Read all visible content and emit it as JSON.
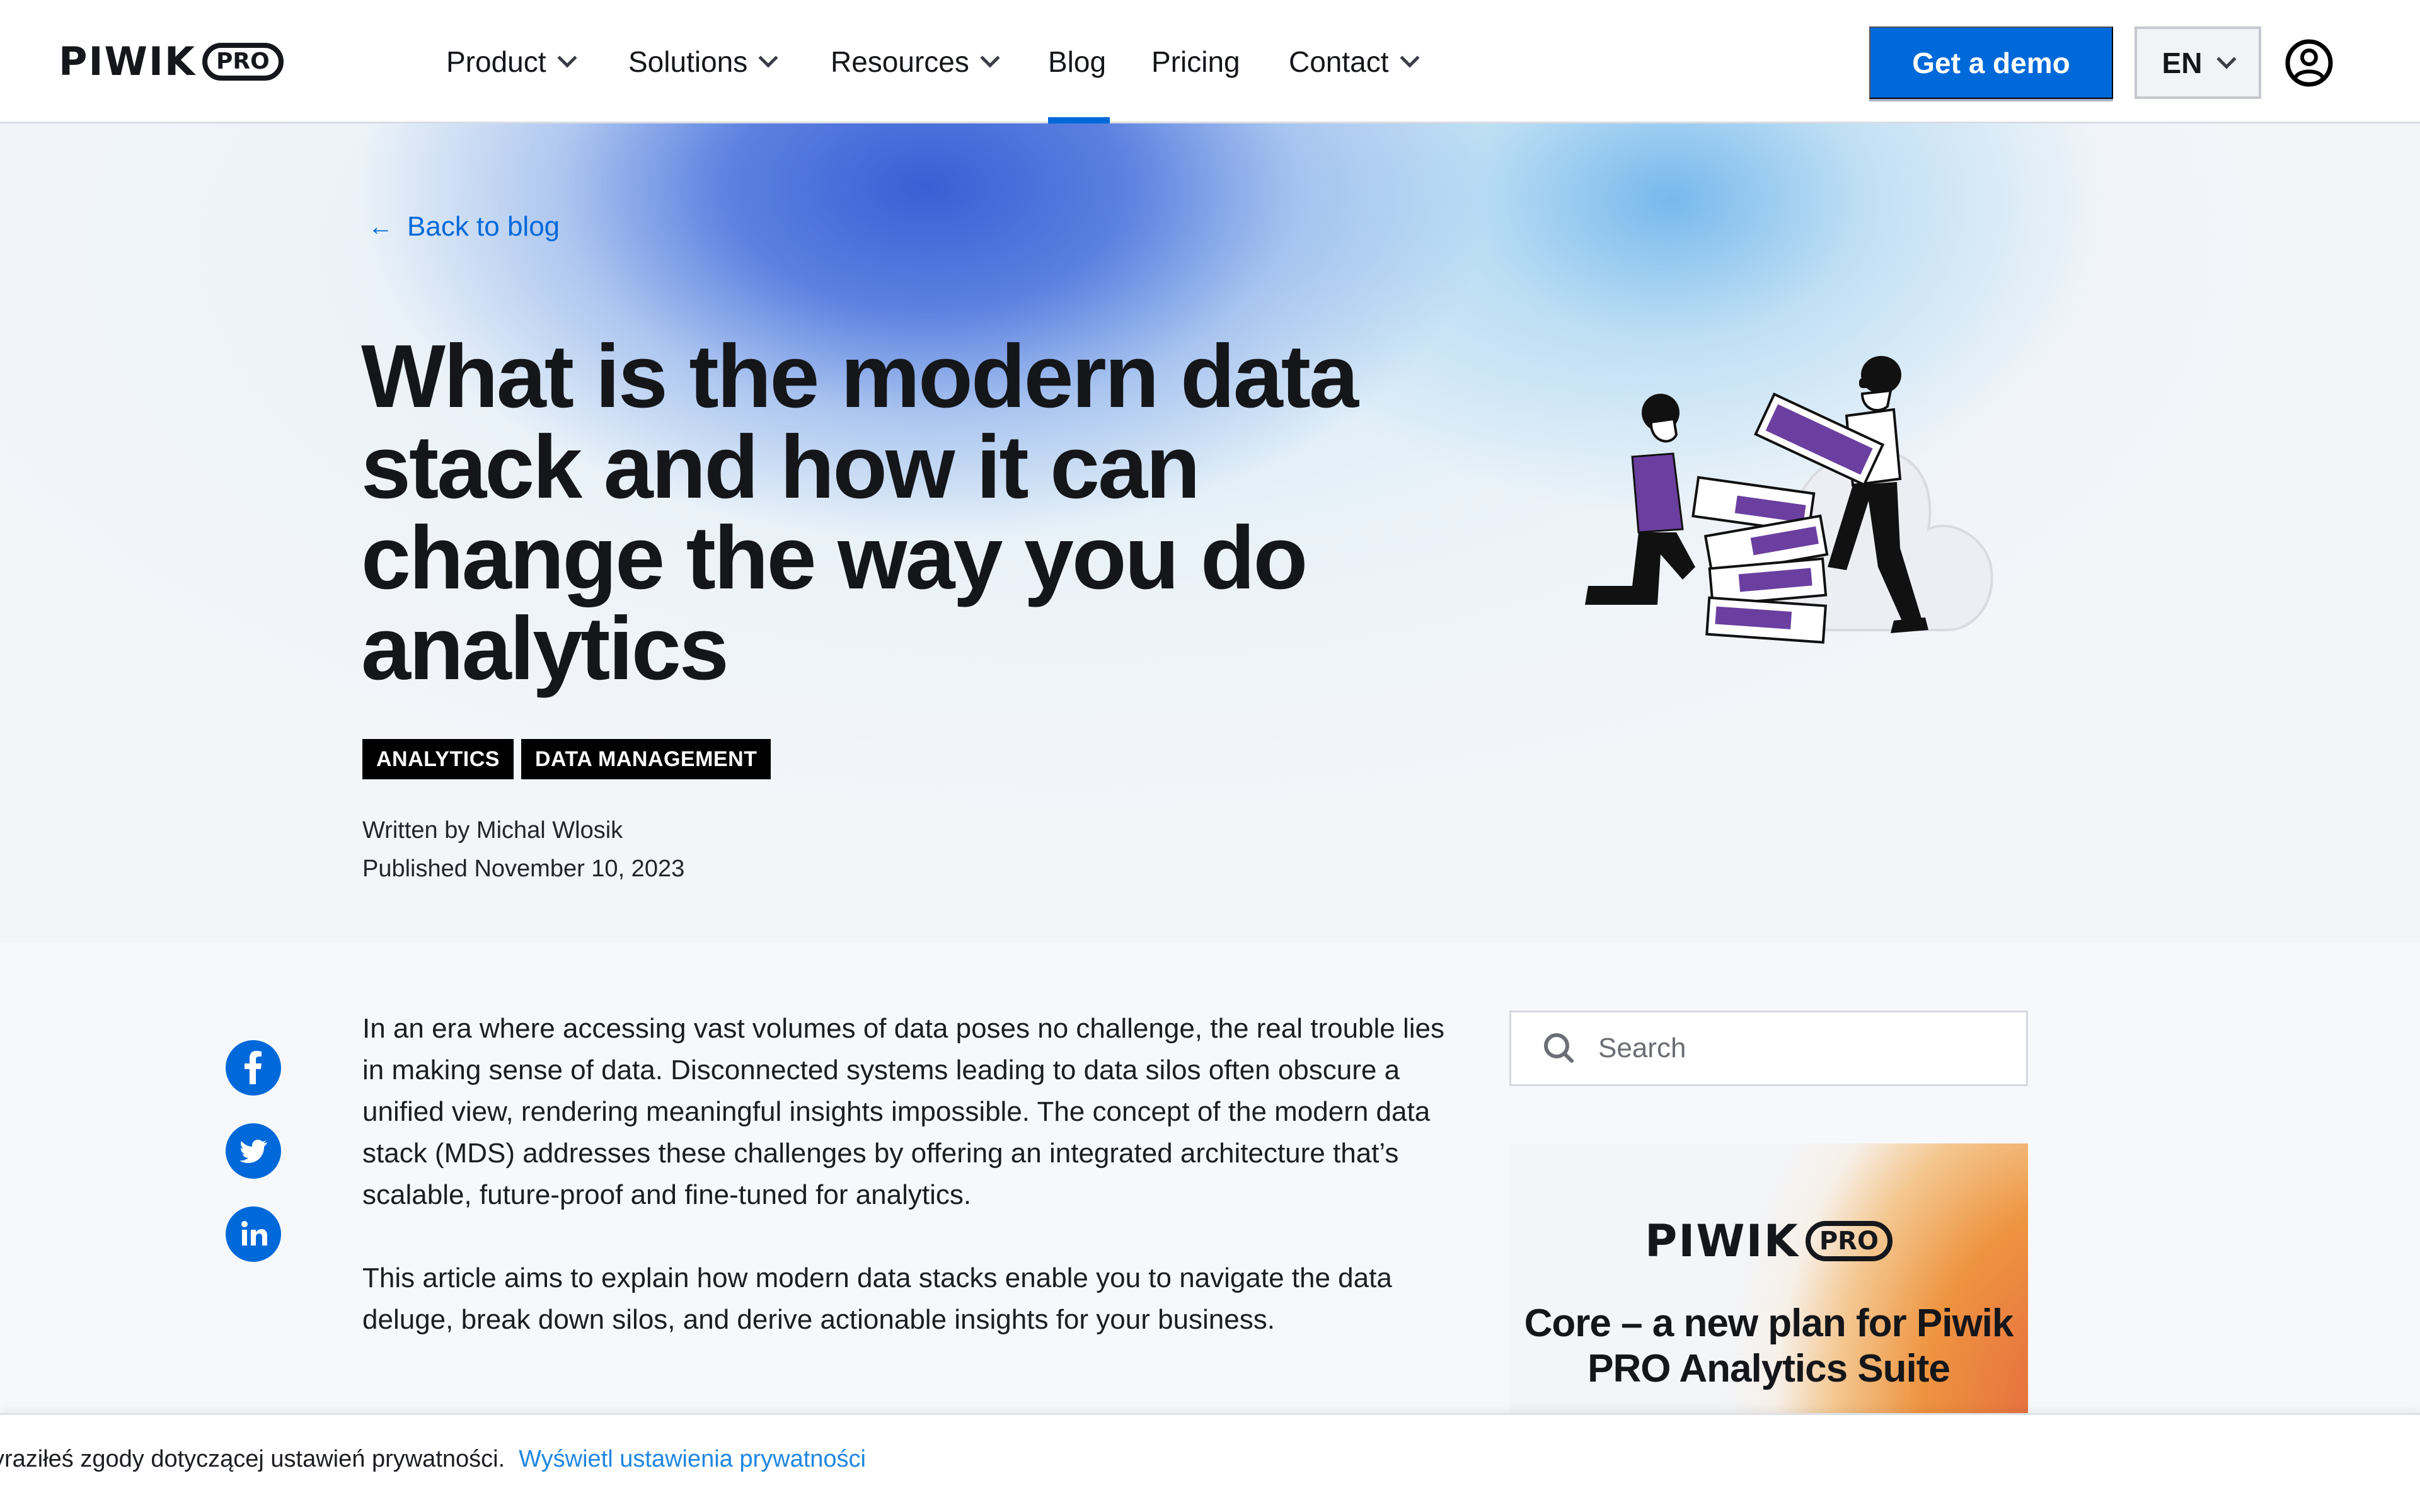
{
  "header": {
    "logo": {
      "word": "PIWIK",
      "pill": "PRO"
    },
    "nav": [
      {
        "label": "Product",
        "has_dropdown": true
      },
      {
        "label": "Solutions",
        "has_dropdown": true
      },
      {
        "label": "Resources",
        "has_dropdown": true
      },
      {
        "label": "Blog",
        "has_dropdown": false,
        "active": true
      },
      {
        "label": "Pricing",
        "has_dropdown": false
      },
      {
        "label": "Contact",
        "has_dropdown": true
      }
    ],
    "demo_button": "Get a demo",
    "language": "EN",
    "account_icon": "user-circle-icon"
  },
  "hero": {
    "back_link": "Back to blog",
    "back_icon": "arrow-left-icon",
    "title": "What is the modern data stack and how it can change the way you do analytics",
    "tags": [
      "ANALYTICS",
      "DATA MANAGEMENT"
    ],
    "author": "Written by Michal Wlosik",
    "published": "Published November 10, 2023",
    "illustration": "two-people-stacking-servers-cloud-illustration"
  },
  "share": [
    {
      "network": "facebook",
      "icon": "facebook-icon",
      "glyph": "f"
    },
    {
      "network": "twitter",
      "icon": "twitter-icon",
      "glyph": ""
    },
    {
      "network": "linkedin",
      "icon": "linkedin-icon",
      "glyph": "in"
    }
  ],
  "article": {
    "paragraphs": [
      "In an era where accessing vast volumes of data poses no challenge, the real trouble lies in making sense of data. Disconnected systems leading to data silos often obscure a unified view, rendering meaningful insights impossible. The concept of the modern data stack (MDS) addresses these challenges by offering an integrated architecture that’s scalable, future-proof and fine-tuned for analytics.",
      "This article aims to explain how modern data stacks enable you to navigate the data deluge, break down silos, and derive actionable insights for your business."
    ]
  },
  "sidebar": {
    "search_placeholder": "Search",
    "promo": {
      "logo_word": "PIWIK",
      "logo_pill": "PRO",
      "title": "Core – a new plan for Piwik PRO Analytics Suite"
    }
  },
  "cookie_bar": {
    "text": "yraziłeś zgody dotyczącej ustawień prywatności.",
    "link": "Wyświetl ustawienia prywatności"
  },
  "colors": {
    "brand_blue": "#0069d9",
    "text_dark": "#14161a",
    "tag_bg": "#000000",
    "cookie_link": "#1f86e0",
    "illustration_purple": "#6b3fa0"
  }
}
